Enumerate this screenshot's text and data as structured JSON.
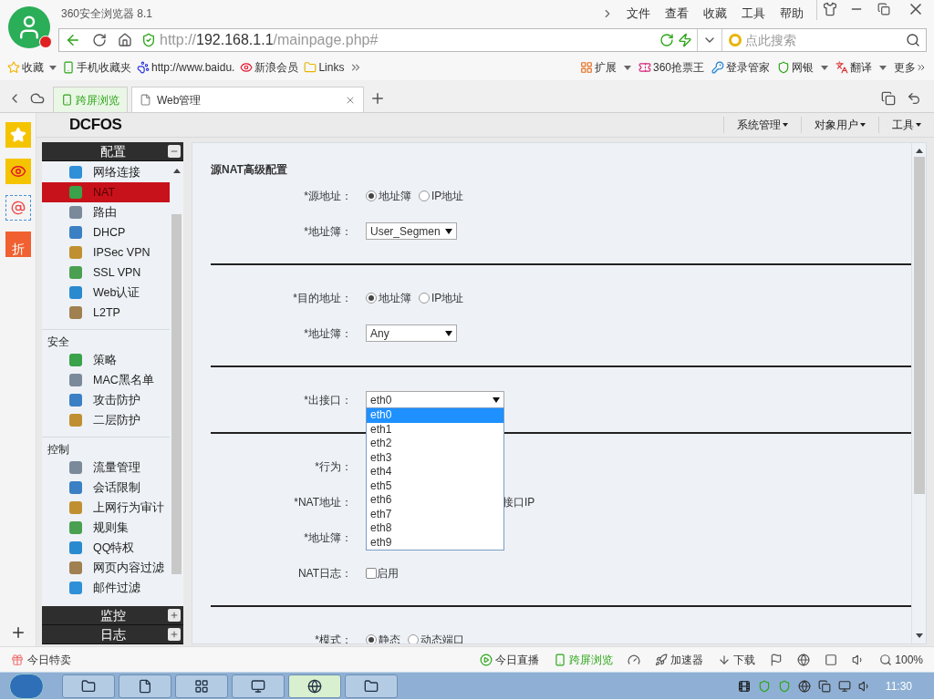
{
  "browser": {
    "title": "360安全浏览器 8.1",
    "menu": [
      "文件",
      "查看",
      "收藏",
      "工具",
      "帮助"
    ]
  },
  "address_bar": {
    "scheme": "http://",
    "host": "192.168.1.1",
    "path": "/mainpage.php#"
  },
  "search": {
    "placeholder": "点此搜索"
  },
  "bookmarks": [
    {
      "label": "收藏",
      "kind": "star",
      "dropdown": true
    },
    {
      "label": "手机收藏夹",
      "kind": "phone",
      "dropdown": false
    },
    {
      "label": "http://www.baidu.",
      "kind": "paw",
      "dropdown": false
    },
    {
      "label": "新浪会员",
      "kind": "eye",
      "dropdown": false
    },
    {
      "label": "Links",
      "kind": "folder",
      "dropdown": false
    }
  ],
  "toolbar_right": [
    {
      "label": "扩展",
      "kind": "grid",
      "dropdown": true
    },
    {
      "label": "360抢票王",
      "kind": "ticket",
      "dropdown": false
    },
    {
      "label": "登录管家",
      "kind": "key",
      "dropdown": false
    },
    {
      "label": "网银",
      "kind": "shield",
      "dropdown": true
    },
    {
      "label": "翻译",
      "kind": "translate",
      "dropdown": true
    },
    {
      "label": "更多",
      "kind": "more",
      "dropdown": false
    }
  ],
  "tabs": [
    {
      "label": "跨屏浏览",
      "selected": false
    },
    {
      "label": "Web管理",
      "selected": true
    }
  ],
  "dock": {
    "badge": "折"
  },
  "app": {
    "logo": "DCFOS",
    "menus": [
      "系统管理",
      "对象用户",
      "工具"
    ]
  },
  "sidebar": {
    "panels": [
      {
        "title": "配置",
        "expanded": true,
        "groups": [
          {
            "items": [
              {
                "label": "网络连接",
                "selected": false
              },
              {
                "label": "NAT",
                "selected": true
              },
              {
                "label": "路由",
                "selected": false
              },
              {
                "label": "DHCP",
                "selected": false
              },
              {
                "label": "IPSec VPN",
                "selected": false
              },
              {
                "label": "SSL VPN",
                "selected": false
              },
              {
                "label": "Web认证",
                "selected": false
              },
              {
                "label": "L2TP",
                "selected": false
              }
            ]
          },
          {
            "heading": "安全",
            "items": [
              {
                "label": "策略",
                "selected": false
              },
              {
                "label": "MAC黑名单",
                "selected": false
              },
              {
                "label": "攻击防护",
                "selected": false
              },
              {
                "label": "二层防护",
                "selected": false
              }
            ]
          },
          {
            "heading": "控制",
            "items": [
              {
                "label": "流量管理",
                "selected": false
              },
              {
                "label": "会话限制",
                "selected": false
              },
              {
                "label": "上网行为审计",
                "selected": false
              },
              {
                "label": "规则集",
                "selected": false
              },
              {
                "label": "QQ特权",
                "selected": false
              },
              {
                "label": "网页内容过滤",
                "selected": false
              },
              {
                "label": "邮件过滤",
                "selected": false
              }
            ]
          }
        ]
      },
      {
        "title": "监控",
        "expanded": false
      },
      {
        "title": "日志",
        "expanded": false
      }
    ]
  },
  "form": {
    "title": "源NAT高级配置",
    "sections": [
      [
        {
          "label": "*源地址：",
          "kind": "radio",
          "options": [
            {
              "label": "地址簿",
              "selected": true
            },
            {
              "label": "IP地址",
              "selected": false
            }
          ]
        },
        {
          "label": "*地址簿：",
          "kind": "select",
          "value": "User_Segmen",
          "expanded": false
        }
      ],
      [
        {
          "label": "*目的地址：",
          "kind": "radio",
          "options": [
            {
              "label": "地址簿",
              "selected": true
            },
            {
              "label": "IP地址",
              "selected": false
            }
          ]
        },
        {
          "label": "*地址簿：",
          "kind": "select",
          "value": "Any",
          "expanded": false
        }
      ],
      [
        {
          "label": "*出接口：",
          "kind": "select",
          "value": "eth0",
          "expanded": true,
          "options": [
            {
              "label": "eth0",
              "selected": true
            },
            {
              "label": "eth1",
              "selected": false
            },
            {
              "label": "eth2",
              "selected": false
            },
            {
              "label": "eth3",
              "selected": false
            },
            {
              "label": "eth4",
              "selected": false
            },
            {
              "label": "eth5",
              "selected": false
            },
            {
              "label": "eth6",
              "selected": false
            },
            {
              "label": "eth7",
              "selected": false
            },
            {
              "label": "eth8",
              "selected": false
            },
            {
              "label": "eth9",
              "selected": false
            }
          ]
        }
      ],
      [
        {
          "label": "*行为：",
          "kind": "blank"
        },
        {
          "label": "*NAT地址：",
          "kind": "partial",
          "text": "接口IP"
        },
        {
          "label": "*地址簿：",
          "kind": "blank"
        },
        {
          "label": "NAT日志：",
          "kind": "checkbox",
          "text": "启用",
          "checked": false
        }
      ],
      [
        {
          "label": "*模式：",
          "kind": "radio",
          "options": [
            {
              "label": "静态",
              "selected": true
            },
            {
              "label": "动态端口",
              "selected": false
            }
          ]
        }
      ]
    ]
  },
  "status_bar": {
    "left": "今日特卖",
    "items": [
      {
        "kind": "play",
        "label": "今日直播"
      },
      {
        "kind": "phone",
        "label": "跨屏浏览"
      },
      {
        "kind": "speed"
      },
      {
        "kind": "rocket",
        "label": "加速器"
      },
      {
        "kind": "download",
        "label": "下载"
      },
      {
        "kind": "flag"
      },
      {
        "kind": "globe"
      },
      {
        "kind": "window"
      },
      {
        "kind": "sound"
      },
      {
        "kind": "zoom",
        "label": "100%"
      }
    ]
  },
  "taskbar": {
    "clock": "11:30"
  }
}
